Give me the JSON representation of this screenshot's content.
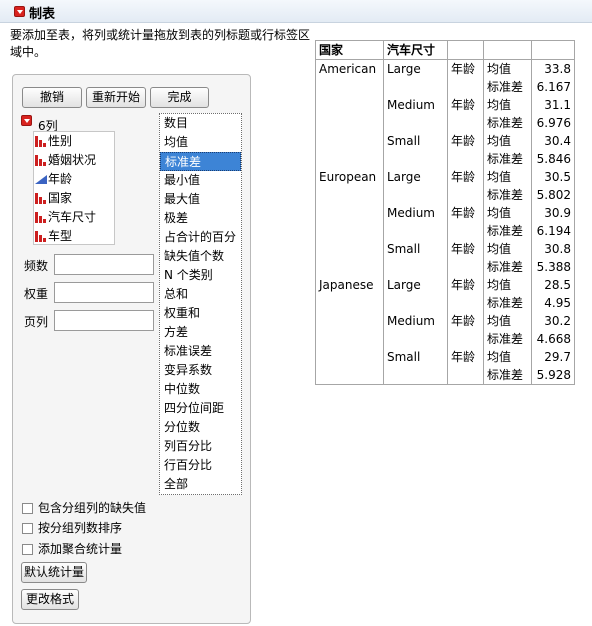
{
  "header": {
    "title": "制表"
  },
  "instructions": "要添加至表，将列或统计量拖放到表的列标题或行标签区域中。",
  "buttons": {
    "undo": "撤销",
    "restart": "重新开始",
    "done": "完成",
    "default_stats": "默认统计量",
    "change_format": "更改格式"
  },
  "columns": {
    "count_label": "6列",
    "items": [
      {
        "label": "性别",
        "icon": "bar-chart-icon"
      },
      {
        "label": "婚姻状况",
        "icon": "bar-chart-icon"
      },
      {
        "label": "年龄",
        "icon": "continuous-icon"
      },
      {
        "label": "国家",
        "icon": "bar-chart-icon"
      },
      {
        "label": "汽车尺寸",
        "icon": "bar-chart-icon"
      },
      {
        "label": "车型",
        "icon": "bar-chart-icon"
      }
    ]
  },
  "roles": {
    "freq": "频数",
    "weight": "权重",
    "page": "页列"
  },
  "statistics": {
    "selected": "标准差",
    "items": [
      "数目",
      "均值",
      "标准差",
      "最小值",
      "最大值",
      "极差",
      "占合计的百分",
      "缺失值个数",
      "N 个类别",
      "总和",
      "权重和",
      "方差",
      "标准误差",
      "变异系数",
      "中位数",
      "四分位间距",
      "分位数",
      "列百分比",
      "行百分比",
      "全部"
    ]
  },
  "checkboxes": {
    "include_missing": "包含分组列的缺失值",
    "order_by_count": "按分组列数排序",
    "add_aggregate": "添加聚合统计量"
  },
  "table": {
    "headers": [
      "国家",
      "汽车尺寸",
      "",
      "",
      ""
    ],
    "rows": [
      [
        "American",
        "Large",
        "年龄",
        "均值",
        "33.8"
      ],
      [
        "",
        "",
        "",
        "标准差",
        "6.167"
      ],
      [
        "",
        "Medium",
        "年龄",
        "均值",
        "31.1"
      ],
      [
        "",
        "",
        "",
        "标准差",
        "6.976"
      ],
      [
        "",
        "Small",
        "年龄",
        "均值",
        "30.4"
      ],
      [
        "",
        "",
        "",
        "标准差",
        "5.846"
      ],
      [
        "European",
        "Large",
        "年龄",
        "均值",
        "30.5"
      ],
      [
        "",
        "",
        "",
        "标准差",
        "5.802"
      ],
      [
        "",
        "Medium",
        "年龄",
        "均值",
        "30.9"
      ],
      [
        "",
        "",
        "",
        "标准差",
        "6.194"
      ],
      [
        "",
        "Small",
        "年龄",
        "均值",
        "30.8"
      ],
      [
        "",
        "",
        "",
        "标准差",
        "5.388"
      ],
      [
        "Japanese",
        "Large",
        "年龄",
        "均值",
        "28.5"
      ],
      [
        "",
        "",
        "",
        "标准差",
        "4.95"
      ],
      [
        "",
        "Medium",
        "年龄",
        "均值",
        "30.2"
      ],
      [
        "",
        "",
        "",
        "标准差",
        "4.668"
      ],
      [
        "",
        "Small",
        "年龄",
        "均值",
        "29.7"
      ],
      [
        "",
        "",
        "",
        "标准差",
        "5.928"
      ]
    ]
  }
}
